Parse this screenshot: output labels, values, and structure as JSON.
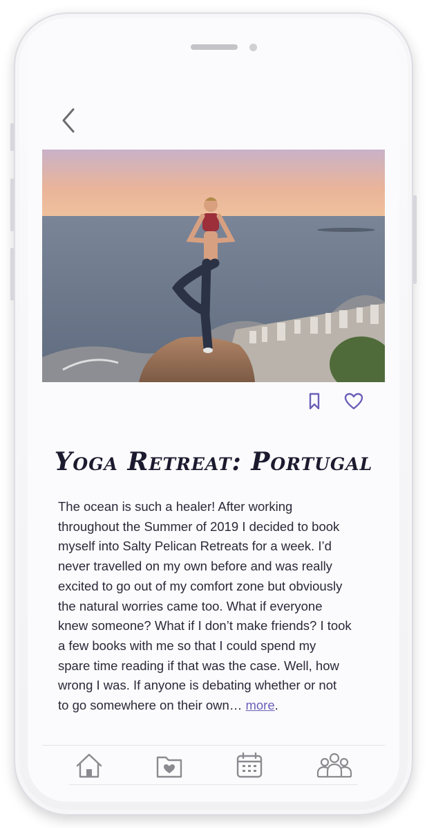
{
  "header": {
    "back_icon": "chevron-left-icon"
  },
  "hero": {
    "description": "photo"
  },
  "actions": {
    "bookmark_icon": "bookmark-icon",
    "like_icon": "heart-icon"
  },
  "post": {
    "title": "Yoga Retreat: Portugal",
    "lines": [
      "The ocean is such a healer! After working",
      "throughout the Summer of 2019 I decided to book",
      "myself into Salty Pelican Retreats for a week. I’d",
      "never travelled on my own before and was really",
      "excited to go out of my comfort zone but obviously",
      "the natural worries came too. What if everyone",
      "knew someone? What if I don’t make friends? I took",
      "a few books with me so that I could spend my",
      "spare time reading if that was the case. Well, how",
      "wrong I was. If anyone is debating whether or not",
      "to go somewhere on their own… "
    ],
    "more_label": "more",
    "more_suffix": "."
  },
  "nav": {
    "items": [
      {
        "icon": "home-icon"
      },
      {
        "icon": "folder-heart-icon"
      },
      {
        "icon": "calendar-icon"
      },
      {
        "icon": "community-icon"
      }
    ]
  },
  "colors": {
    "accent": "#6b5fb8",
    "text": "#2a2938",
    "icon_gray": "#8a8a90"
  }
}
